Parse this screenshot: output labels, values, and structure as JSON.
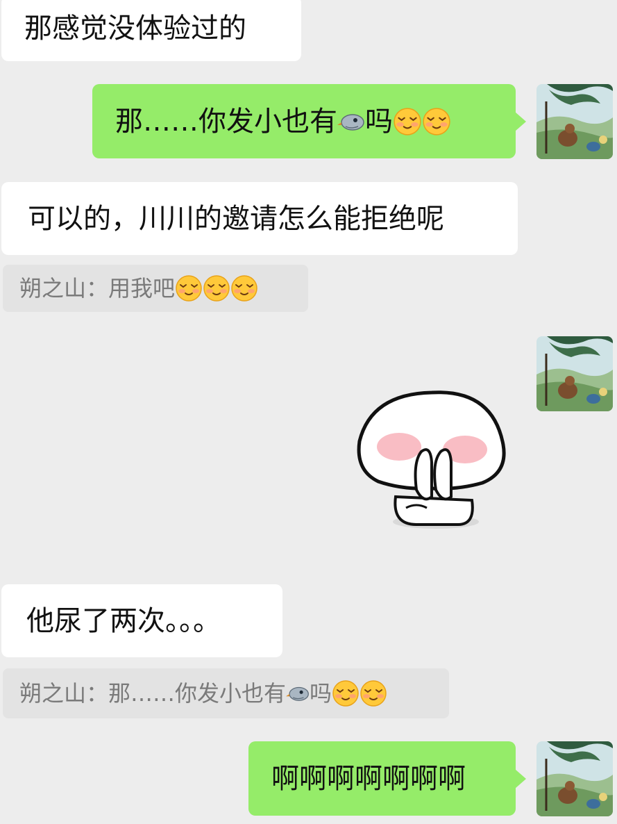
{
  "messages": [
    {
      "side": "in",
      "text": "那感觉没体验过的"
    },
    {
      "side": "out",
      "text_before": "那……你发小也有",
      "text_after": "吗",
      "inline_icons": [
        "bird-icon",
        "smirk-face-icon",
        "smirk-face-icon"
      ]
    },
    {
      "side": "in",
      "text": "可以的，川川的邀请怎么能拒绝呢"
    },
    {
      "side": "in",
      "quote": {
        "sender": "朔之山：",
        "text": "用我吧",
        "inline_icons": [
          "smirk-face-icon",
          "smirk-face-icon",
          "smirk-face-icon"
        ]
      }
    },
    {
      "side": "out",
      "sticker": "shy-mushroom-sticker"
    },
    {
      "side": "in",
      "text": "他尿了两次。。。"
    },
    {
      "side": "in",
      "quote": {
        "sender": "朔之山：",
        "text_before": "那……你发小也有",
        "text_after": "吗",
        "inline_icons": [
          "bird-icon",
          "smirk-face-icon",
          "smirk-face-icon"
        ]
      }
    },
    {
      "side": "out",
      "text": "啊啊啊啊啊啊啊"
    }
  ],
  "colors": {
    "background": "#ededed",
    "outgoing_bubble": "#95ec69",
    "incoming_bubble": "#ffffff",
    "quote_background": "#e3e3e3",
    "quote_text": "#7a7a7a"
  },
  "avatar_icon": "landscape-avatar-icon"
}
